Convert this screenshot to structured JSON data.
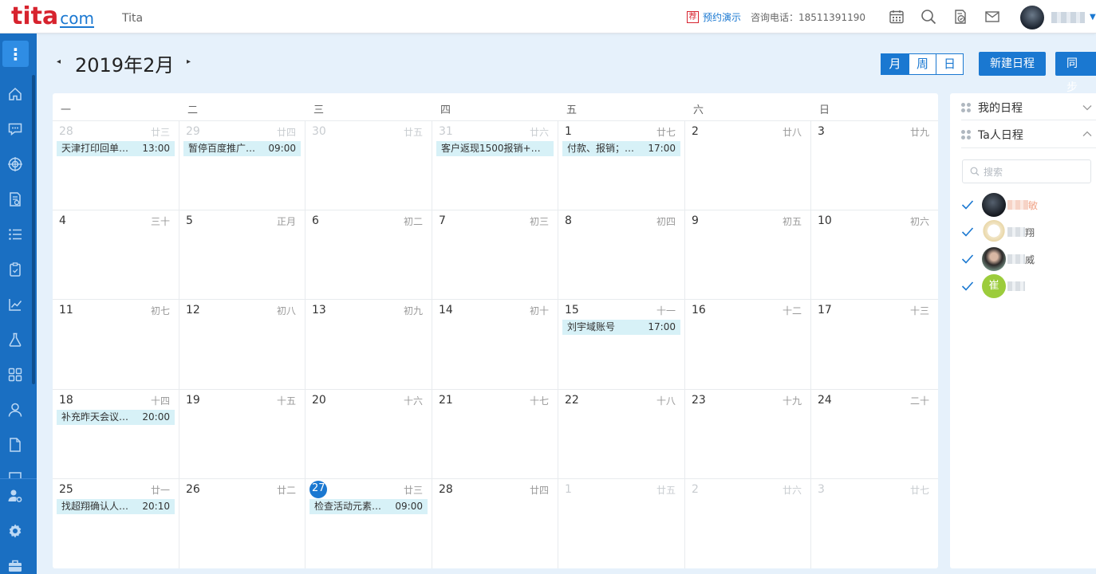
{
  "header": {
    "app_name": "Tita",
    "promo_badge": "荐",
    "promo_link": "预约演示",
    "hotline": "咨询电话：18511391190"
  },
  "toolbar": {
    "month_title": "2019年2月",
    "prev_label": "◂",
    "next_label": "▸",
    "view_month": "月",
    "view_week": "周",
    "view_day": "日",
    "active_view": "月",
    "new_event": "新建日程",
    "sync": "同步"
  },
  "weekdays": [
    "一",
    "二",
    "三",
    "四",
    "五",
    "六",
    "日"
  ],
  "weeks": [
    [
      {
        "day": "28",
        "lunar": "廿三",
        "other": true,
        "event": {
          "title": "天津打印回单，…",
          "time": "13:00"
        }
      },
      {
        "day": "29",
        "lunar": "廿四",
        "other": true,
        "event": {
          "title": "暂停百度推广和…",
          "time": "09:00"
        }
      },
      {
        "day": "30",
        "lunar": "廿五",
        "other": true
      },
      {
        "day": "31",
        "lunar": "廿六",
        "other": true,
        "event": {
          "title": "客户返现1500报销+微…",
          "time": ""
        }
      },
      {
        "day": "1",
        "lunar": "廿七",
        "event": {
          "title": "付款、报销；暂…",
          "time": "17:00"
        }
      },
      {
        "day": "2",
        "lunar": "廿八"
      },
      {
        "day": "3",
        "lunar": "廿九"
      }
    ],
    [
      {
        "day": "4",
        "lunar": "三十"
      },
      {
        "day": "5",
        "lunar": "正月"
      },
      {
        "day": "6",
        "lunar": "初二"
      },
      {
        "day": "7",
        "lunar": "初三"
      },
      {
        "day": "8",
        "lunar": "初四"
      },
      {
        "day": "9",
        "lunar": "初五"
      },
      {
        "day": "10",
        "lunar": "初六"
      }
    ],
    [
      {
        "day": "11",
        "lunar": "初七"
      },
      {
        "day": "12",
        "lunar": "初八"
      },
      {
        "day": "13",
        "lunar": "初九"
      },
      {
        "day": "14",
        "lunar": "初十"
      },
      {
        "day": "15",
        "lunar": "十一",
        "event": {
          "title": "刘宇域账号",
          "time": "17:00"
        }
      },
      {
        "day": "16",
        "lunar": "十二"
      },
      {
        "day": "17",
        "lunar": "十三"
      }
    ],
    [
      {
        "day": "18",
        "lunar": "十四",
        "event": {
          "title": "补充昨天会议日…",
          "time": "20:00"
        }
      },
      {
        "day": "19",
        "lunar": "十五"
      },
      {
        "day": "20",
        "lunar": "十六"
      },
      {
        "day": "21",
        "lunar": "十七"
      },
      {
        "day": "22",
        "lunar": "十八"
      },
      {
        "day": "23",
        "lunar": "十九"
      },
      {
        "day": "24",
        "lunar": "二十"
      }
    ],
    [
      {
        "day": "25",
        "lunar": "廿一",
        "event": {
          "title": "找超翔确认人员…",
          "time": "20:10"
        }
      },
      {
        "day": "26",
        "lunar": "廿二"
      },
      {
        "day": "27",
        "lunar": "廿三",
        "today": true,
        "event": {
          "title": "检查活动元素下…",
          "time": "09:00"
        }
      },
      {
        "day": "28",
        "lunar": "廿四"
      },
      {
        "day": "1",
        "lunar": "廿五",
        "other": true
      },
      {
        "day": "2",
        "lunar": "廿六",
        "other": true
      },
      {
        "day": "3",
        "lunar": "廿七",
        "other": true
      }
    ]
  ],
  "right_panel": {
    "my_schedule": "我的日程",
    "others_schedule": "Ta人日程",
    "search_placeholder": "搜索",
    "people": [
      {
        "name_suffix": "敏",
        "avatar": "dark-photo",
        "checked": true
      },
      {
        "name_suffix": "翔",
        "avatar": "cartoon",
        "checked": true
      },
      {
        "name_suffix": "威",
        "avatar": "photo-woman",
        "checked": true
      },
      {
        "name_suffix": "",
        "avatar_letter": "崔",
        "avatar_color": "#9ccc3c",
        "checked": true
      }
    ]
  },
  "colors": {
    "brand_red": "#d7232e",
    "brand_blue": "#1a78d1",
    "sidebar": "#1a6fc2",
    "event_bg": "#d7f1f7",
    "page_bg": "#e6f1fb"
  }
}
